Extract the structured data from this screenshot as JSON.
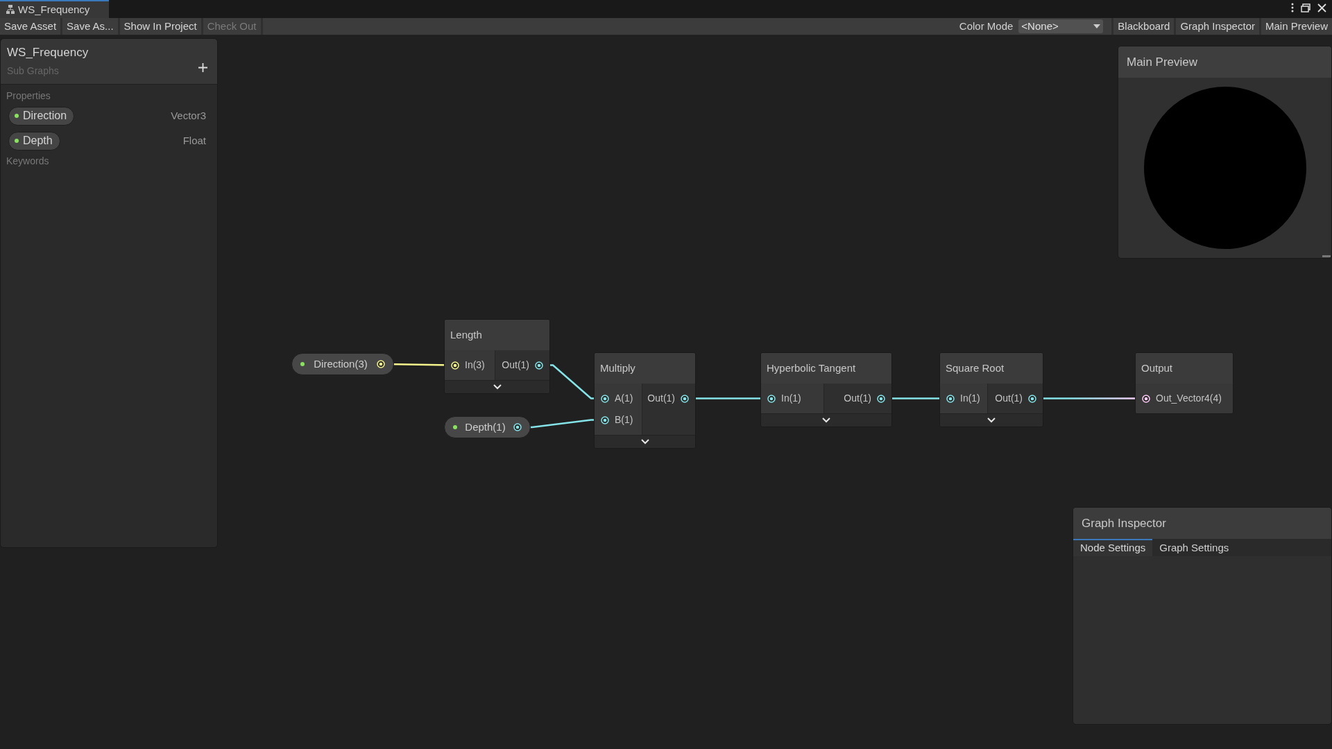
{
  "window": {
    "tab_title": "WS_Frequency"
  },
  "toolbar": {
    "left_buttons": [
      {
        "label": "Save Asset",
        "disabled": false
      },
      {
        "label": "Save As...",
        "disabled": false
      },
      {
        "label": "Show In Project",
        "disabled": false
      },
      {
        "label": "Check Out",
        "disabled": true
      }
    ],
    "color_mode": {
      "label": "Color Mode",
      "value": "<None>"
    },
    "right_buttons": [
      {
        "label": "Blackboard"
      },
      {
        "label": "Graph Inspector"
      },
      {
        "label": "Main Preview"
      }
    ]
  },
  "blackboard": {
    "title": "WS_Frequency",
    "subtitle": "Sub Graphs",
    "sections": [
      {
        "title": "Properties",
        "items": [
          {
            "name": "Direction",
            "type": "Vector3",
            "exposed": true
          },
          {
            "name": "Depth",
            "type": "Float",
            "exposed": true
          }
        ]
      },
      {
        "title": "Keywords"
      }
    ]
  },
  "graph": {
    "nodes": [
      {
        "kind": "property",
        "label": "Direction(3)",
        "exposed": true,
        "color": "#f4f38c"
      },
      {
        "kind": "node",
        "title": "Length",
        "inputs": [
          {
            "label": "In(3)",
            "color": "#f4f38c"
          }
        ],
        "outputs": [
          {
            "label": "Out(1)",
            "color": "#84e4e7"
          }
        ],
        "expandable": true
      },
      {
        "kind": "property",
        "label": "Depth(1)",
        "exposed": true,
        "color": "#84e4e7"
      },
      {
        "kind": "node",
        "title": "Multiply",
        "inputs": [
          {
            "label": "A(1)",
            "color": "#84e4e7"
          },
          {
            "label": "B(1)",
            "color": "#84e4e7"
          }
        ],
        "outputs": [
          {
            "label": "Out(1)",
            "color": "#84e4e7"
          }
        ],
        "expandable": true
      },
      {
        "kind": "node",
        "title": "Hyperbolic Tangent",
        "inputs": [
          {
            "label": "In(1)",
            "color": "#84e4e7"
          }
        ],
        "outputs": [
          {
            "label": "Out(1)",
            "color": "#84e4e7"
          }
        ],
        "expandable": true
      },
      {
        "kind": "node",
        "title": "Square Root",
        "inputs": [
          {
            "label": "In(1)",
            "color": "#84e4e7"
          }
        ],
        "outputs": [
          {
            "label": "Out(1)",
            "color": "#84e4e7"
          }
        ],
        "expandable": true
      },
      {
        "kind": "node",
        "title": "Output",
        "inputs": [
          {
            "label": "Out_Vector4(4)",
            "color": "#fbcbf4"
          }
        ],
        "expandable": false
      }
    ]
  },
  "main_preview": {
    "title": "Main Preview"
  },
  "graph_inspector": {
    "title": "Graph Inspector",
    "tabs": [
      {
        "label": "Node Settings",
        "selected": true
      },
      {
        "label": "Graph Settings",
        "selected": false
      }
    ]
  }
}
